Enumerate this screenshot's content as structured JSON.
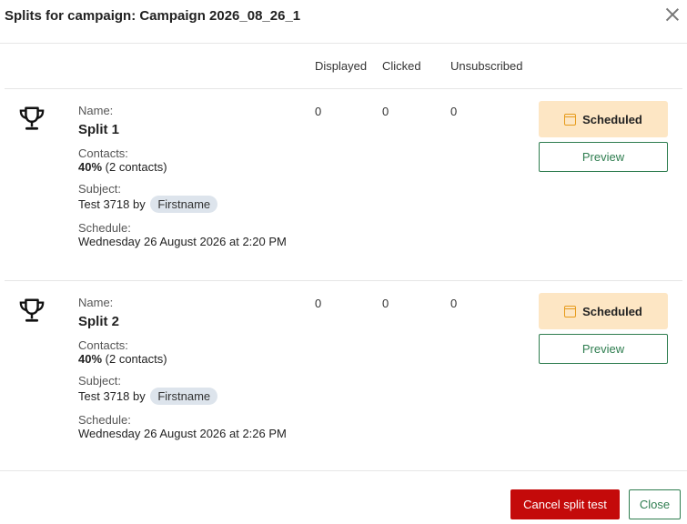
{
  "modal": {
    "title": "Splits for campaign: Campaign 2026_08_26_1"
  },
  "columns": {
    "displayed": "Displayed",
    "clicked": "Clicked",
    "unsubscribed": "Unsubscribed"
  },
  "labels": {
    "name": "Name:",
    "contacts": "Contacts:",
    "subject": "Subject:",
    "schedule": "Schedule:"
  },
  "splits": [
    {
      "name": "Split 1",
      "contacts_pct": "40%",
      "contacts_count": " (2 contacts)",
      "subject_text": "Test 3718 by",
      "subject_tag": "Firstname",
      "schedule": "Wednesday 26 August 2026 at 2:20 PM",
      "displayed": "0",
      "clicked": "0",
      "unsubscribed": "0",
      "status": "Scheduled",
      "preview_label": "Preview"
    },
    {
      "name": "Split 2",
      "contacts_pct": "40%",
      "contacts_count": " (2 contacts)",
      "subject_text": "Test 3718 by",
      "subject_tag": "Firstname",
      "schedule": "Wednesday 26 August 2026 at 2:26 PM",
      "displayed": "0",
      "clicked": "0",
      "unsubscribed": "0",
      "status": "Scheduled",
      "preview_label": "Preview"
    }
  ],
  "footer": {
    "cancel_label": "Cancel split test",
    "close_label": "Close"
  },
  "icons": {
    "close": "close-icon",
    "trophy": "trophy-icon",
    "calendar": "calendar-icon"
  },
  "colors": {
    "danger": "#c40a0a",
    "accent": "#2e7d4f",
    "scheduled_bg": "#fde6c4",
    "calendar": "#e69a1a"
  }
}
